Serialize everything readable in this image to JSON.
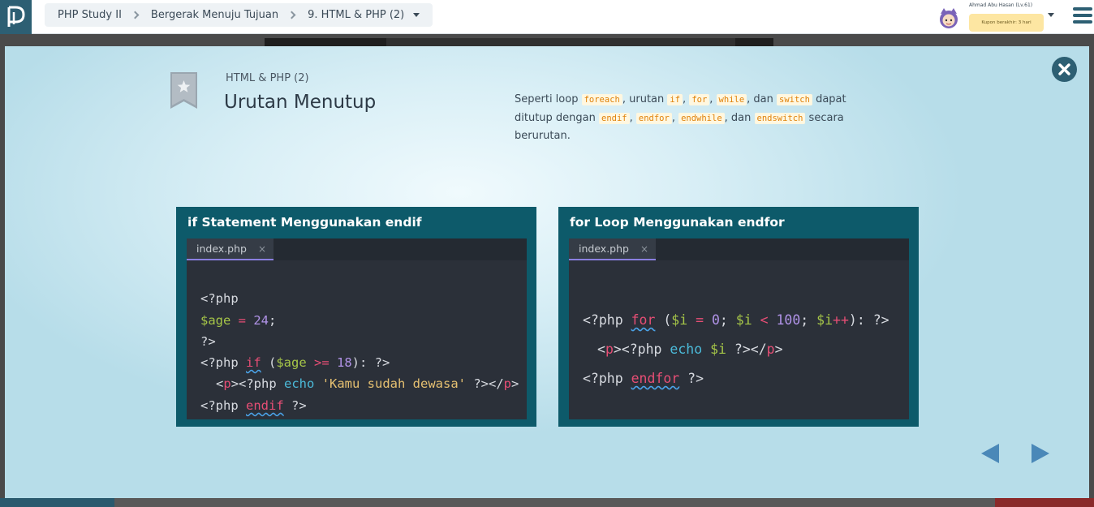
{
  "header": {
    "breadcrumb": [
      "PHP Study II",
      "Bergerak Menuju Tujuan",
      "9. HTML & PHP (2)"
    ],
    "user_name": "Ahmad Abu Hasan (Lv.61)",
    "coupon": "Kupon berakhir: 3 hari"
  },
  "lesson": {
    "subtitle": "HTML & PHP (2)",
    "title": "Urutan Menutup",
    "desc": {
      "t1": "Seperti loop ",
      "c1": "foreach",
      "t2": ", urutan ",
      "c2": "if",
      "t3": ", ",
      "c3": "for",
      "t4": ", ",
      "c4": "while",
      "t5": ", dan ",
      "c5": "switch",
      "t6": " dapat ditutup dengan ",
      "c6": "endif",
      "t7": ", ",
      "c7": "endfor",
      "t8": ", ",
      "c8": "endwhile",
      "t9": ", dan ",
      "c9": "endswitch",
      "t10": " secara berurutan."
    }
  },
  "panels": [
    {
      "title": "if Statement Menggunakan endif",
      "tab": "index.php",
      "code": {
        "l1": "<?php",
        "l2_var": "$age",
        "l2_eq": " = ",
        "l2_num": "24",
        "l2_end": ";",
        "l3": "?>",
        "l4_a": "<?php ",
        "l4_if": "if",
        "l4_b": " (",
        "l4_var": "$age",
        "l4_op": " >= ",
        "l4_num": "18",
        "l4_c": "): ?>",
        "l5_a": "<",
        "l5_p": "p",
        "l5_b": "><?php ",
        "l5_echo": "echo",
        "l5_c": " ",
        "l5_str": "'Kamu sudah dewasa'",
        "l5_d": " ?></",
        "l5_p2": "p",
        "l5_e": ">",
        "l6_a": "<?php ",
        "l6_endif": "endif",
        "l6_b": " ?>"
      }
    },
    {
      "title": "for Loop Menggunakan endfor",
      "tab": "index.php",
      "code": {
        "l1_a": "<?php ",
        "l1_for": "for",
        "l1_b": " (",
        "l1_var1": "$i",
        "l1_eq": " = ",
        "l1_zero": "0",
        "l1_c": "; ",
        "l1_var2": "$i",
        "l1_lt": " < ",
        "l1_hund": "100",
        "l1_d": "; ",
        "l1_var3": "$i",
        "l1_inc": "++",
        "l1_e": "): ?>",
        "l2_a": "<",
        "l2_p": "p",
        "l2_b": "><?php ",
        "l2_echo": "echo",
        "l2_c": " ",
        "l2_var": "$i",
        "l2_d": " ?></",
        "l2_p2": "p",
        "l2_e": ">",
        "l3_a": "<?php ",
        "l3_endfor": "endfor",
        "l3_b": " ?>"
      }
    }
  ],
  "colors": {
    "brand": "#2d5f73",
    "panel_bg": "#0d5a6a",
    "editor_bg": "#2b3039",
    "keyword": "#e74e75",
    "variable": "#a6c648",
    "number": "#b193e8",
    "function": "#4bbad9",
    "string": "#e6c071",
    "inline_code": "#e0820a",
    "nav_arrow": "#4a88b8"
  }
}
